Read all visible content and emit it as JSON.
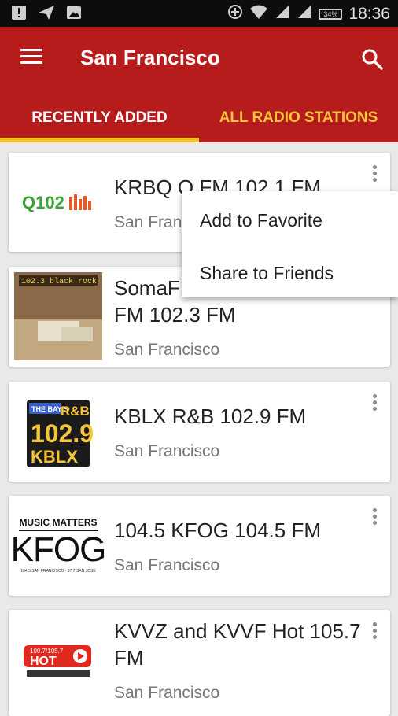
{
  "status_bar": {
    "time": "18:36",
    "battery": "34%"
  },
  "app_bar": {
    "title": "San Francisco"
  },
  "tabs": [
    {
      "label": "RECENTLY ADDED",
      "active": true
    },
    {
      "label": "ALL RADIO STATIONS",
      "active": false
    }
  ],
  "stations": [
    {
      "name": "KRBQ Q FM 102.1 FM",
      "city": "San Francisco",
      "logo_text": "Q102.1"
    },
    {
      "name": "SomaFM Black Rock FM 102.3 FM",
      "name_visible": "SomaF",
      "name_line2": "FM 102.3 FM",
      "city": "San Francisco",
      "logo_text": "102.3 black rock"
    },
    {
      "name": "KBLX R&B 102.9 FM",
      "city": "San Francisco",
      "logo_text": "THE BAY'S R&B 102.9 KBLX"
    },
    {
      "name": "104.5 KFOG 104.5 FM",
      "city": "San Francisco",
      "logo_top": "MUSIC MATTERS",
      "logo_text": "KFOG",
      "logo_sub": "104.5 SAN FRANCISCO - 97.7 SAN JOSE"
    },
    {
      "name": "KVVZ and KVVF Hot 105.7 FM",
      "city": "San Francisco",
      "logo_top": "100.7/105.7",
      "logo_text": "HOT"
    }
  ],
  "popup_menu": {
    "items": [
      "Add to Favorite",
      "Share to Friends"
    ]
  },
  "colors": {
    "app_bar": "#b71c1c",
    "tab_accent": "#f5c128",
    "background": "#e9e9e9"
  }
}
